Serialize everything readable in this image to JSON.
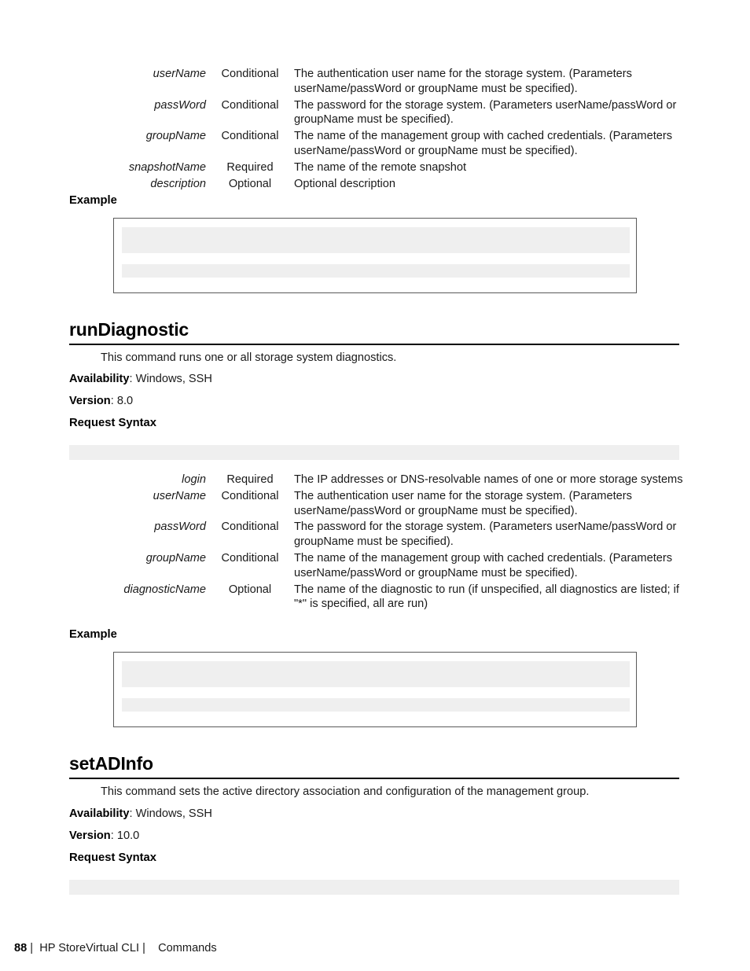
{
  "document": {
    "title": "HP StoreVirtual CLI",
    "chapter": "Commands",
    "page_number": "88"
  },
  "footer": {
    "page_number": "88",
    "separator_1": "|",
    "title": "HP StoreVirtual CLI",
    "separator_2": "|",
    "chapter": "Commands"
  },
  "top_params": {
    "rows": [
      {
        "name": "userName",
        "requirement": "Conditional",
        "description": "The authentication user name for the storage system. (Parameters userName/passWord or groupName must be specified)."
      },
      {
        "name": "passWord",
        "requirement": "Conditional",
        "description": "The password for the storage system. (Parameters userName/passWord or groupName must be specified)."
      },
      {
        "name": "groupName",
        "requirement": "Conditional",
        "description": "The name of the management group with cached credentials. (Parameters userName/passWord or groupName must be specified)."
      },
      {
        "name": "snapshotName",
        "requirement": "Required",
        "description": "The name of the remote snapshot"
      },
      {
        "name": "description",
        "requirement": "Optional",
        "description": "Optional description"
      }
    ]
  },
  "example_1": {
    "heading": "Example",
    "content": ""
  },
  "run_diagnostic": {
    "heading": "runDiagnostic",
    "description": "This command runs one or all storage system diagnostics.",
    "availability_label": "Availability",
    "availability_value": ": Windows, SSH",
    "version_label": "Version",
    "version_value": ": 8.0",
    "request_syntax_label": "Request Syntax",
    "request_syntax_content": "",
    "params": [
      {
        "name": "login",
        "requirement": "Required",
        "description": "The IP addresses or DNS-resolvable names of one or more storage systems"
      },
      {
        "name": "userName",
        "requirement": "Conditional",
        "description": "The authentication user name for the storage system. (Parameters userName/passWord or groupName must be specified)."
      },
      {
        "name": "passWord",
        "requirement": "Conditional",
        "description": "The password for the storage system. (Parameters userName/passWord or groupName must be specified)."
      },
      {
        "name": "groupName",
        "requirement": "Conditional",
        "description": "The name of the management group with cached credentials. (Parameters userName/passWord or groupName must be specified)."
      },
      {
        "name": "diagnosticName",
        "requirement": "Optional",
        "description": "The name of the diagnostic to run (if unspecified, all diagnostics are listed; if \"*\" is specified, all are run)"
      }
    ]
  },
  "example_2": {
    "heading": "Example",
    "content": ""
  },
  "set_ad_info": {
    "heading": "setADInfo",
    "description": "This command sets the active directory association and configuration of the management group.",
    "availability_label": "Availability",
    "availability_value": ": Windows, SSH",
    "version_label": "Version",
    "version_value": ": 10.0",
    "request_syntax_label": "Request Syntax",
    "request_syntax_content": ""
  },
  "colors": {
    "page_background": "#ffffff",
    "text": "#1a1a1a",
    "heading": "#000000",
    "syntax_bar": "#efefef",
    "example_border": "#5a5a5a",
    "example_block": "#efefef"
  }
}
